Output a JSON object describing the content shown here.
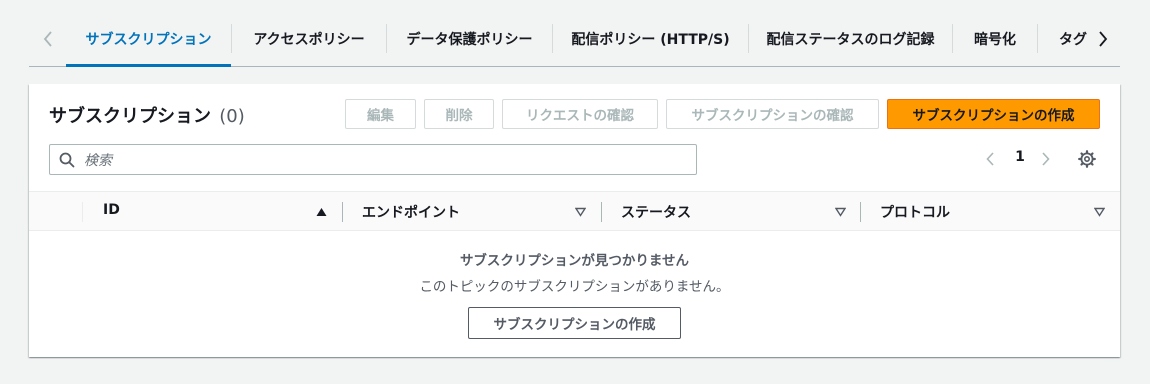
{
  "tabs": [
    {
      "label": "サブスクリプション",
      "active": true
    },
    {
      "label": "アクセスポリシー"
    },
    {
      "label": "データ保護ポリシー"
    },
    {
      "label": "配信ポリシー (HTTP/S)"
    },
    {
      "label": "配信ステータスのログ記録"
    },
    {
      "label": "暗号化"
    },
    {
      "label": "タグ"
    }
  ],
  "panel": {
    "title": "サブスクリプション",
    "count": "(0)",
    "buttons": {
      "edit": "編集",
      "delete": "削除",
      "request_confirm": "リクエストの確認",
      "confirm_subscription": "サブスクリプションの確認",
      "create_subscription": "サブスクリプションの作成"
    },
    "search": {
      "placeholder": "検索",
      "value": ""
    },
    "pagination": {
      "current_page": "1"
    }
  },
  "table": {
    "columns": [
      "ID",
      "エンドポイント",
      "ステータス",
      "プロトコル"
    ],
    "sort": {
      "column": "ID",
      "direction": "ascending"
    },
    "empty": {
      "title": "サブスクリプションが見つかりません",
      "description": "このトピックのサブスクリプションがありません。",
      "button": "サブスクリプションの作成"
    }
  },
  "colors": {
    "accent": "#0073bb",
    "primary_button": "#ff9900",
    "background": "#f2f3f3"
  },
  "icons": [
    "chevron-left-icon",
    "chevron-right-icon",
    "search-icon",
    "settings-gear-icon",
    "sort-ascending-icon",
    "sort-descending-icon"
  ]
}
